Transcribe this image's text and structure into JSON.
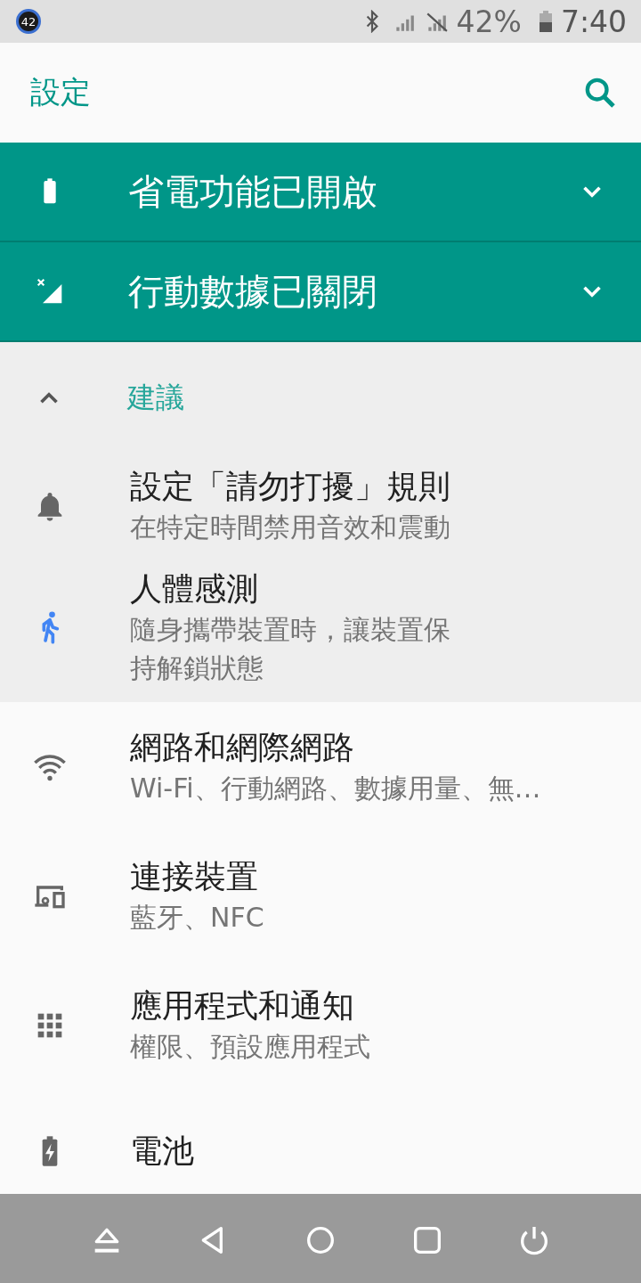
{
  "status_bar": {
    "badge": "42",
    "battery": "42%",
    "time": "7:40"
  },
  "app_bar": {
    "title": "設定"
  },
  "conditions": [
    {
      "title": "省電功能已開啟",
      "expanded": false
    },
    {
      "title": "行動數據已關閉",
      "expanded": false
    }
  ],
  "suggestions": {
    "title": "建議",
    "expanded": true,
    "items": [
      {
        "title": "設定「請勿打擾」規則",
        "subtitle": "在特定時間禁用音效和震動"
      },
      {
        "title": "人體感測",
        "subtitle": "隨身攜帶裝置時，讓裝置保持解鎖狀態"
      }
    ]
  },
  "settings": [
    {
      "title": "網路和網際網路",
      "subtitle": "Wi-Fi、行動網路、數據用量、無…"
    },
    {
      "title": "連接裝置",
      "subtitle": "藍牙、NFC"
    },
    {
      "title": "應用程式和通知",
      "subtitle": "權限、預設應用程式"
    },
    {
      "title": "電池"
    }
  ]
}
